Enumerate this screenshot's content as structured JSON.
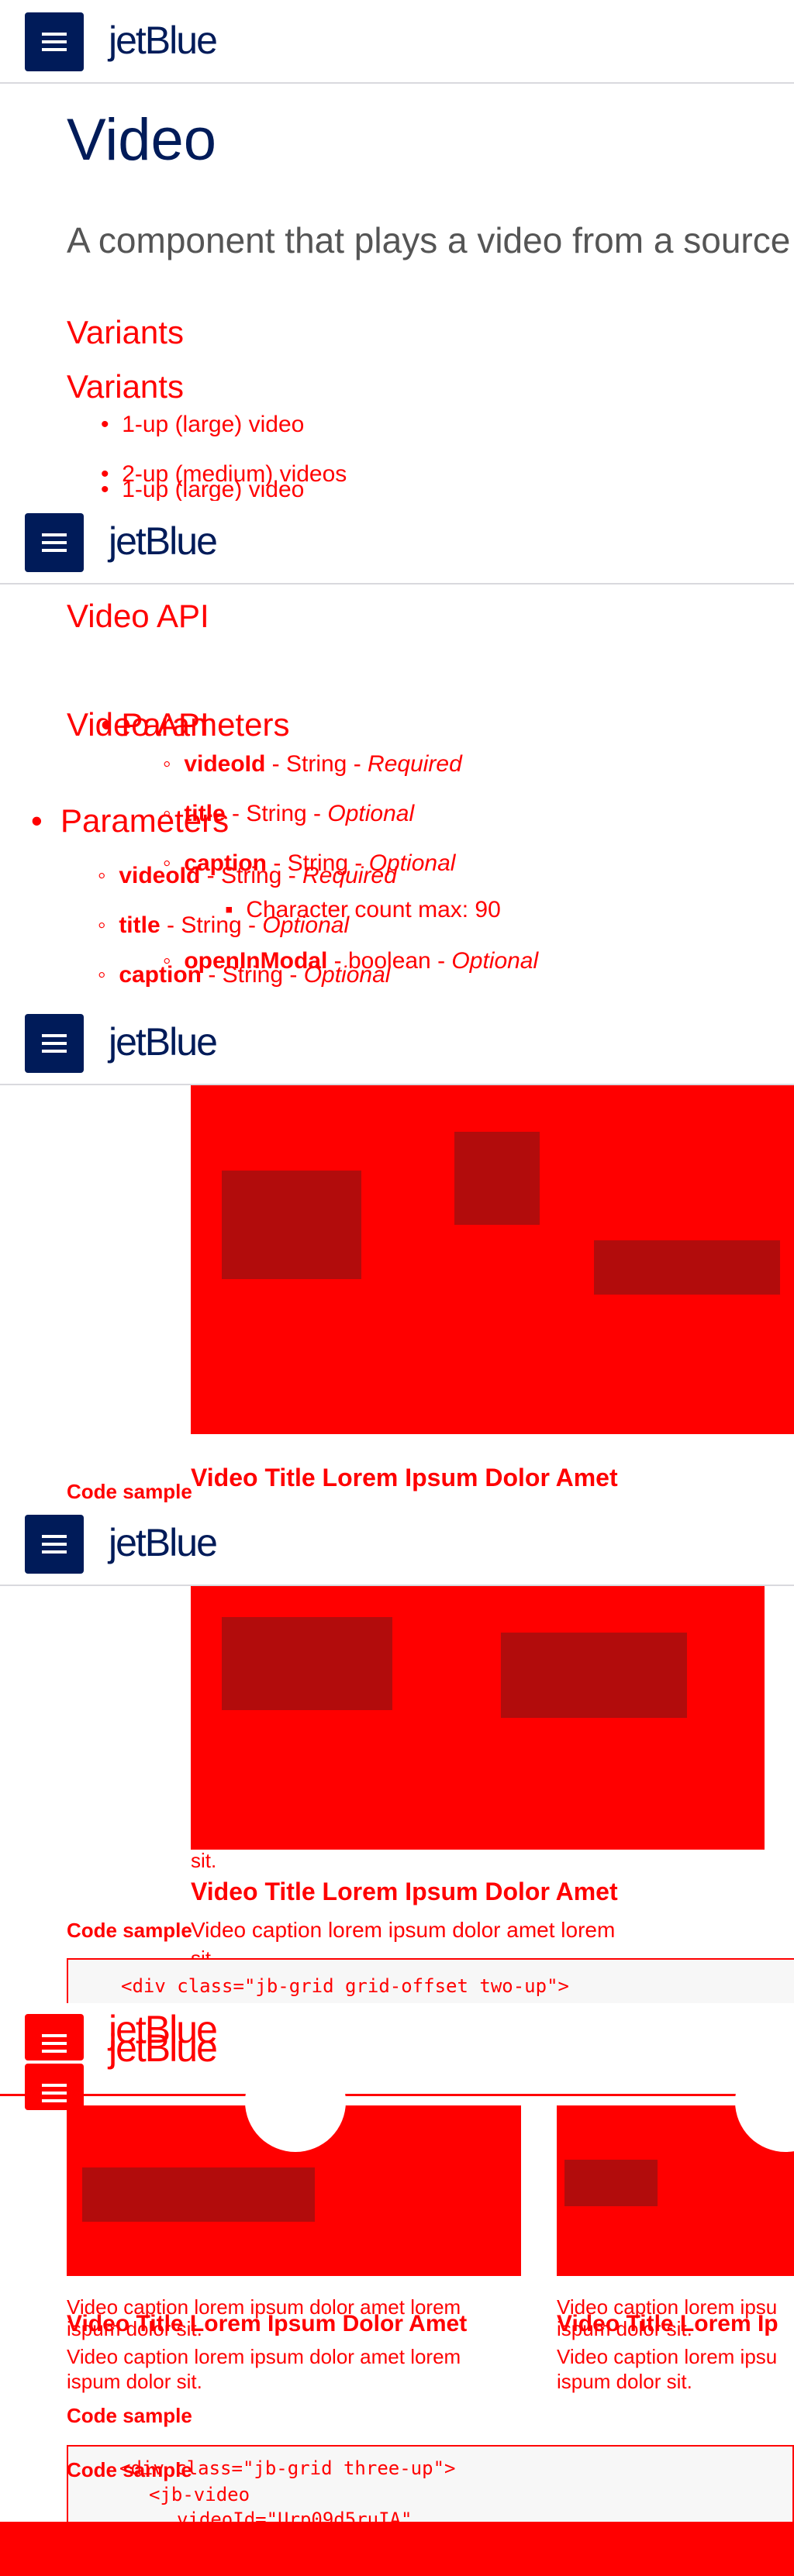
{
  "brand": {
    "logo": "jetBlue",
    "accent": "#001b59",
    "alert": "#ff0000",
    "background": "#ffffff"
  },
  "header": {
    "menu_icon": "hamburger-menu-icon",
    "logo_text": "jetBlue"
  },
  "page": {
    "title": "Video",
    "intro": "A component that plays a video from a source"
  },
  "variants": {
    "heading": "Variants",
    "heading_repeat": "Variants",
    "items": [
      "1-up (large) video",
      "2-up (medium) videos",
      "1-up (large) video"
    ]
  },
  "api": {
    "heading": "Video API",
    "heading_repeat": "Video API",
    "parameters_heading": "Parameters",
    "params": [
      {
        "name": "videoId",
        "type": "String",
        "req": "Required"
      },
      {
        "name": "title",
        "type": "String",
        "req": "Optional"
      },
      {
        "name": "caption",
        "type": "String",
        "req": "Optional"
      },
      {
        "name": "openInModal",
        "type": "boolean",
        "req": "Optional"
      }
    ],
    "caption_note": "Character count max: 90"
  },
  "samples": {
    "code_label": "Code sample",
    "video_title": "Video Title Lorem Ipsum Dolor Amet",
    "video_title_cut": "Video Title Lorem Ip",
    "caption": "Video caption lorem ipsum dolor amet lorem ipsum dolor sit.",
    "caption_line1": "Video caption lorem ipsum dolor amet lorem",
    "caption_line2": "ispum dolor sit.",
    "caption_cut1": "Video caption lorem ipsu",
    "caption_cut2": "ispum dolor sit.",
    "sit": "sit.",
    "code_two_up": "<div class=\"jb-grid grid-offset two-up\">",
    "code_three_up": "<div class=\"jb-grid three-up\">",
    "code_jb_video": "<jb-video",
    "code_video_id": "videoId=\"Urp09d5ruIA\""
  }
}
